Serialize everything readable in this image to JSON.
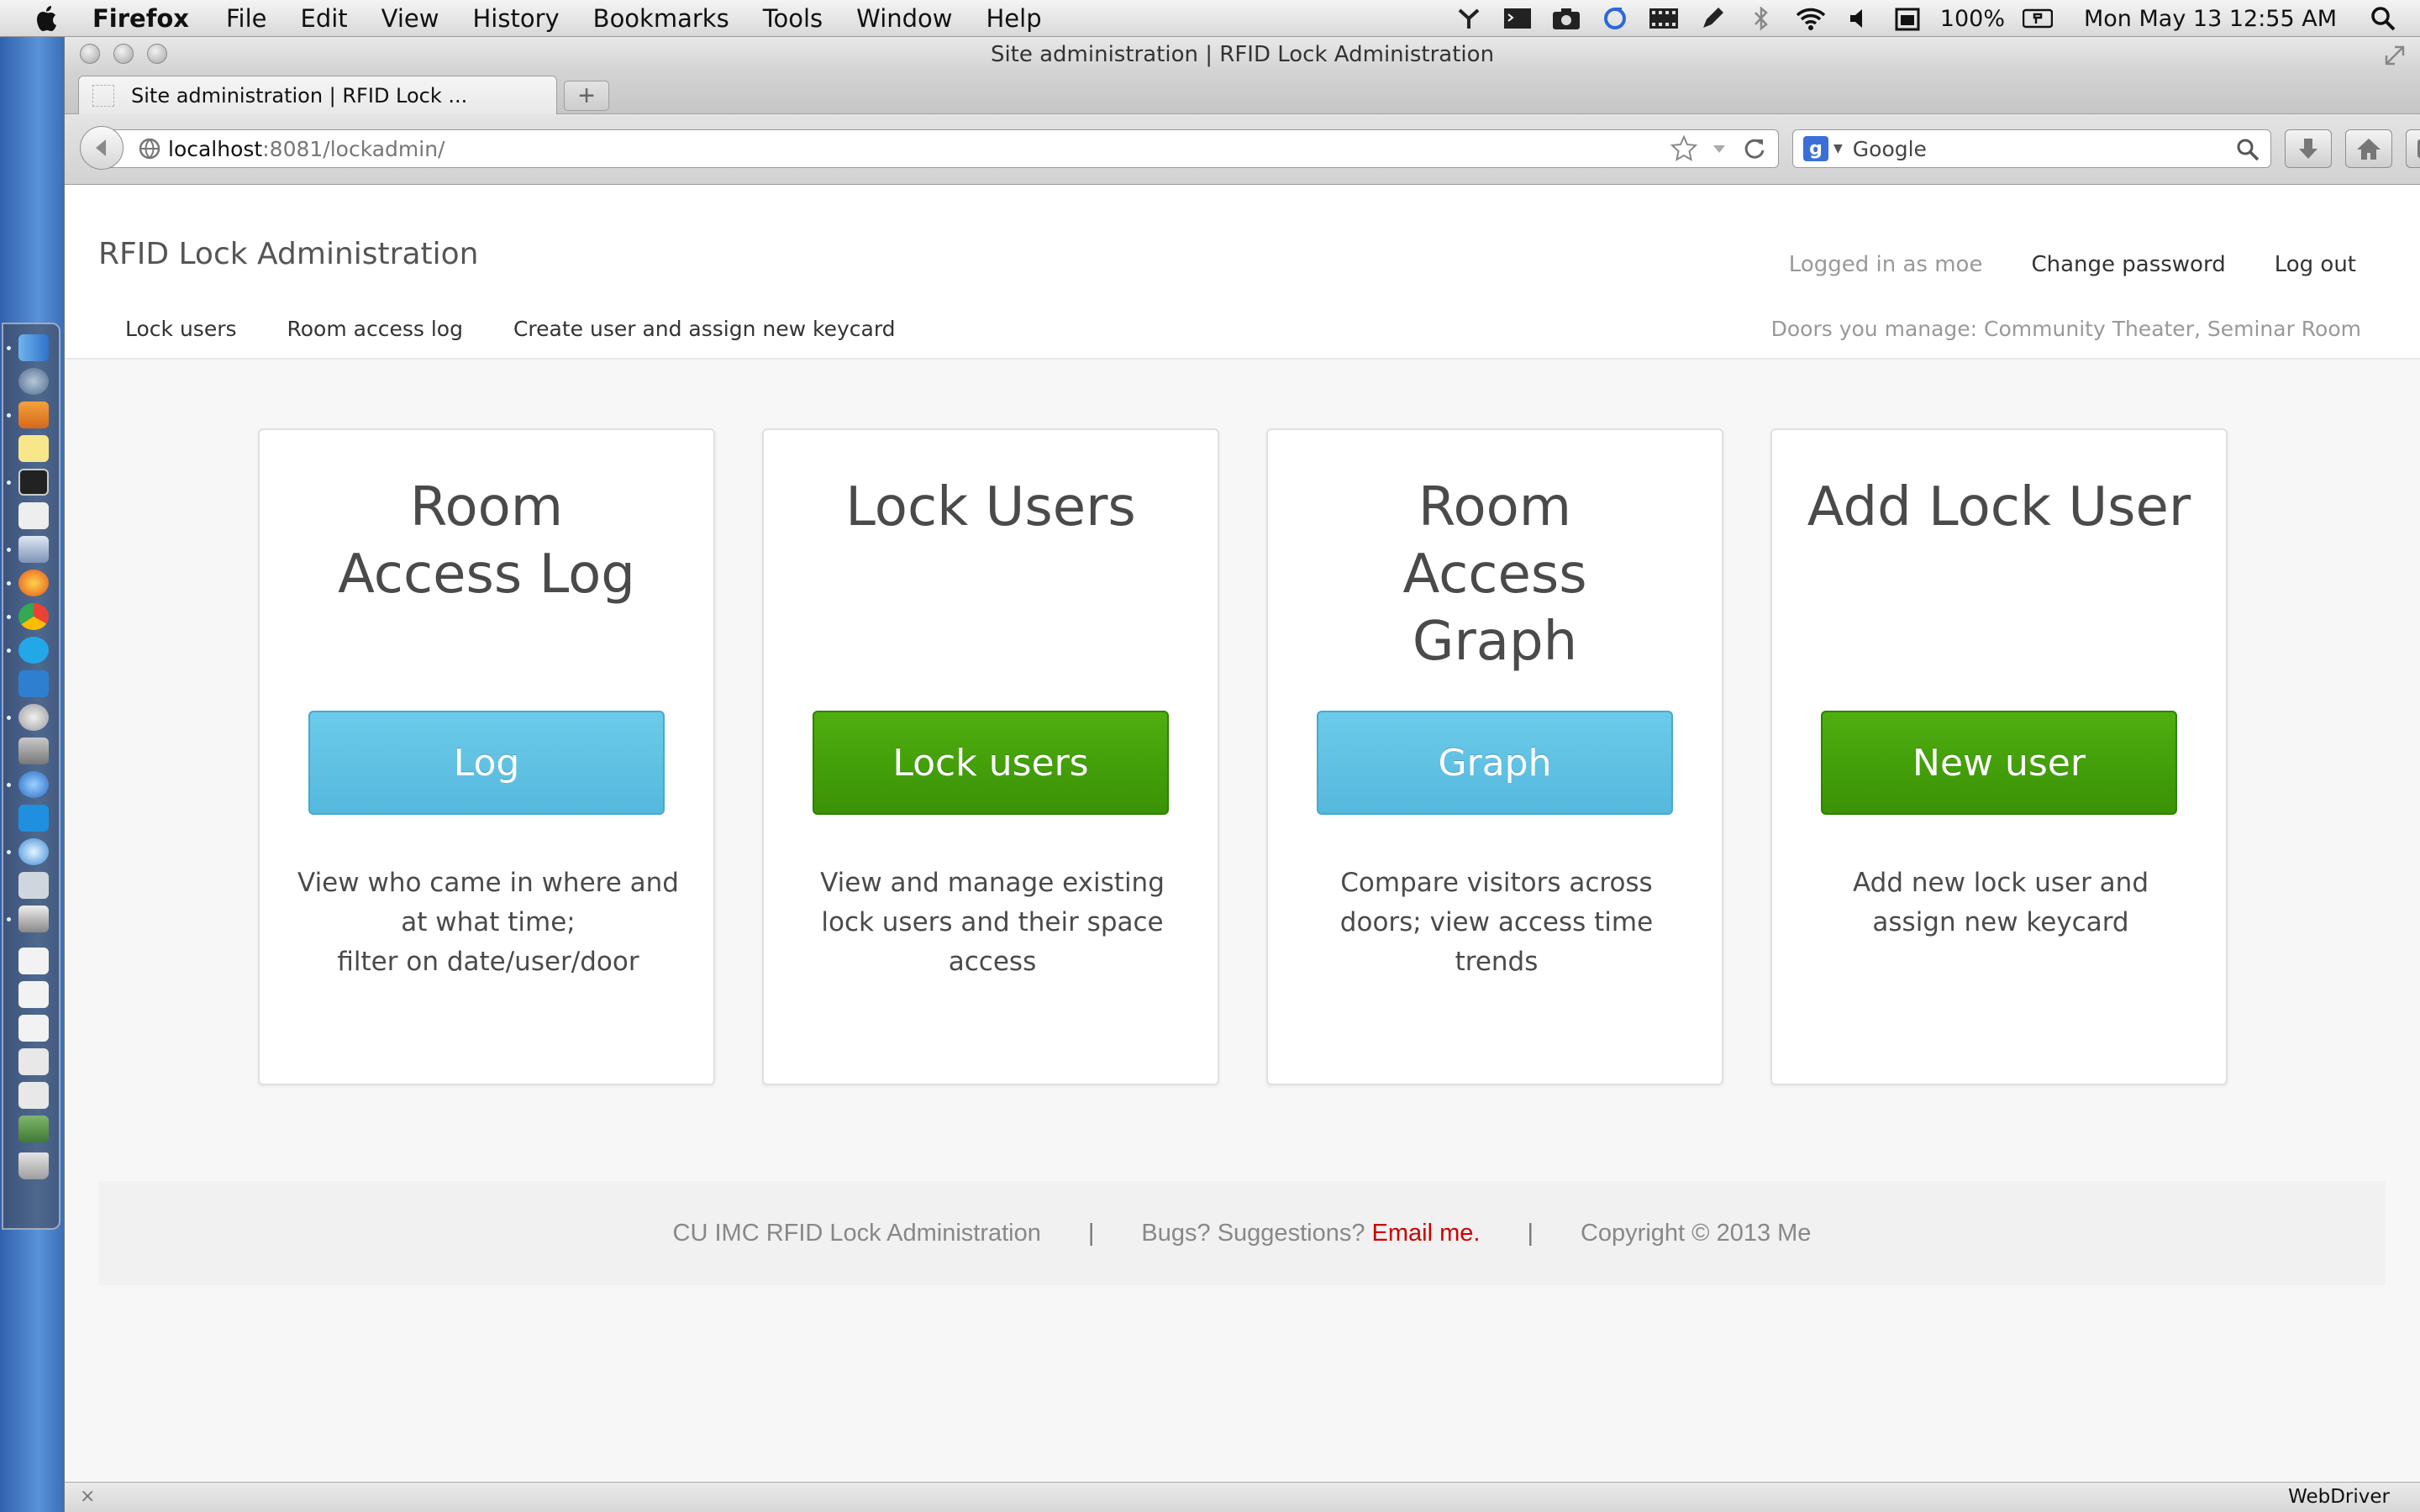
{
  "menubar": {
    "app_name": "Firefox",
    "items": [
      "File",
      "Edit",
      "View",
      "History",
      "Bookmarks",
      "Tools",
      "Window",
      "Help"
    ],
    "battery": "100%",
    "clock": "Mon May 13  12:55 AM"
  },
  "browser": {
    "window_title": "Site administration | RFID Lock Administration",
    "tab_title": "Site administration | RFID Lock ...",
    "new_tab_label": "+",
    "url_host": "localhost",
    "url_path": ":8081/lockadmin/",
    "search_placeholder": "Google",
    "search_engine_letter": "g",
    "status_text": "WebDriver",
    "status_close": "×"
  },
  "header": {
    "brand": "RFID Lock Administration",
    "logged_in": "Logged in as moe",
    "change_password": "Change password",
    "logout": "Log out",
    "nav": [
      "Lock users",
      "Room access log",
      "Create user and assign new keycard"
    ],
    "doors": "Doors you manage: Community Theater, Seminar Room"
  },
  "cards": [
    {
      "title": "Room Access Log",
      "button": "Log",
      "desc_line1": "View who came in where and at what time;",
      "desc_line2": "filter on date/user/door"
    },
    {
      "title": "Lock Users",
      "button": "Lock users",
      "desc_line1": "View and manage existing lock users and their space access",
      "desc_line2": ""
    },
    {
      "title": "Room Access Graph",
      "button": "Graph",
      "desc_line1": "Compare visitors across doors; view access time trends",
      "desc_line2": ""
    },
    {
      "title": "Add Lock User",
      "button": "New user",
      "desc_line1": "Add new lock user and assign new keycard",
      "desc_line2": ""
    }
  ],
  "footer": {
    "site": "CU IMC RFID Lock Administration",
    "separator": "|",
    "bugs": "Bugs? Suggestions?",
    "email": "Email me.",
    "copyright": "Copyright © 2013 Me"
  },
  "colors": {
    "info_button": "#5bc0de",
    "success_button": "#3e9a08",
    "footer_link": "#cc0000"
  }
}
